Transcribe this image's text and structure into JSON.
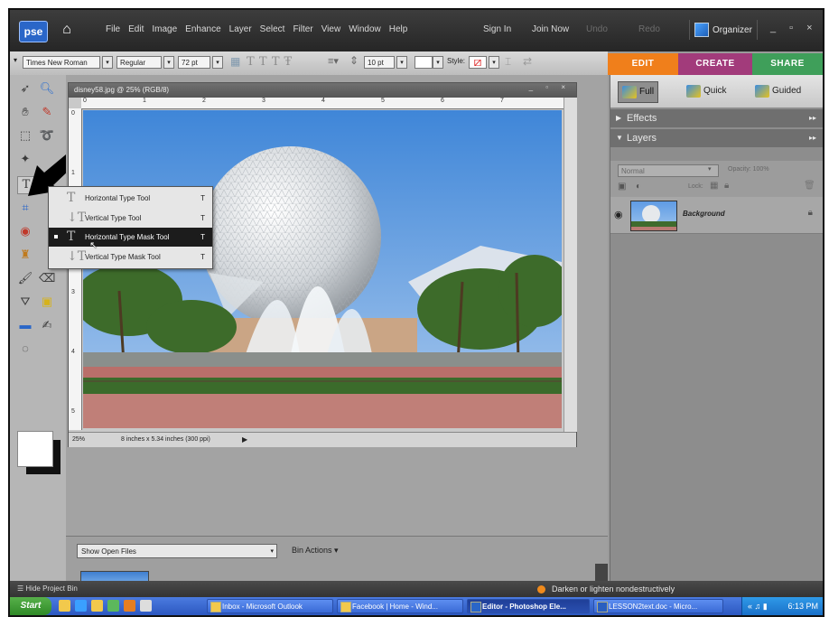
{
  "app": {
    "logo": "pse",
    "menus": [
      "File",
      "Edit",
      "Image",
      "Enhance",
      "Layer",
      "Select",
      "Filter",
      "View",
      "Window",
      "Help"
    ],
    "sign_in": "Sign In",
    "join_now": "Join Now",
    "undo": "Undo",
    "redo": "Redo",
    "organizer": "Organizer",
    "window_controls": "_ ▫ ×"
  },
  "mode_tabs": {
    "edit": "EDIT",
    "create": "CREATE",
    "share": "SHARE"
  },
  "options_bar": {
    "font_family": "Times New Roman",
    "font_style": "Regular",
    "font_size": "72 pt",
    "leading": "10 pt",
    "style_label": "Style:"
  },
  "document": {
    "title": "disney58.jpg @ 25% (RGB/8)",
    "zoom": "25%",
    "info": "8 inches x 5.34 inches (300 ppi)",
    "ruler_h": [
      "0",
      "1",
      "2",
      "3",
      "4",
      "5",
      "6",
      "7"
    ],
    "ruler_v": [
      "0",
      "1",
      "2",
      "3",
      "4",
      "5"
    ]
  },
  "type_flyout": {
    "items": [
      {
        "label": "Horizontal Type Tool",
        "key": "T"
      },
      {
        "label": "Vertical Type Tool",
        "key": "T"
      },
      {
        "label": "Horizontal Type Mask Tool",
        "key": "T"
      },
      {
        "label": "Vertical Type Mask Tool",
        "key": "T"
      }
    ]
  },
  "panel": {
    "views": {
      "full": "Full",
      "quick": "Quick",
      "guided": "Guided"
    },
    "effects": "Effects",
    "layers": "Layers",
    "blend_mode": "Normal",
    "opacity_label": "Opacity:",
    "opacity_value": "100%",
    "lock_label": "Lock:",
    "layer_name": "Background"
  },
  "project_bin": {
    "select": "Show Open Files",
    "actions": "Bin Actions"
  },
  "statusbar": {
    "hide_bin": "Hide Project Bin",
    "hint": "Darken or lighten nondestructively"
  },
  "taskbar": {
    "start": "Start",
    "tasks": [
      "Inbox - Microsoft Outlook",
      "Facebook | Home - Wind...",
      "Editor - Photoshop Ele...",
      "LESSON2text.doc - Micro..."
    ],
    "clock": "6:13 PM"
  },
  "colors": {
    "edit_tab": "#f07f1b",
    "create_tab": "#a23b7b",
    "share_tab": "#3f9f5a"
  }
}
